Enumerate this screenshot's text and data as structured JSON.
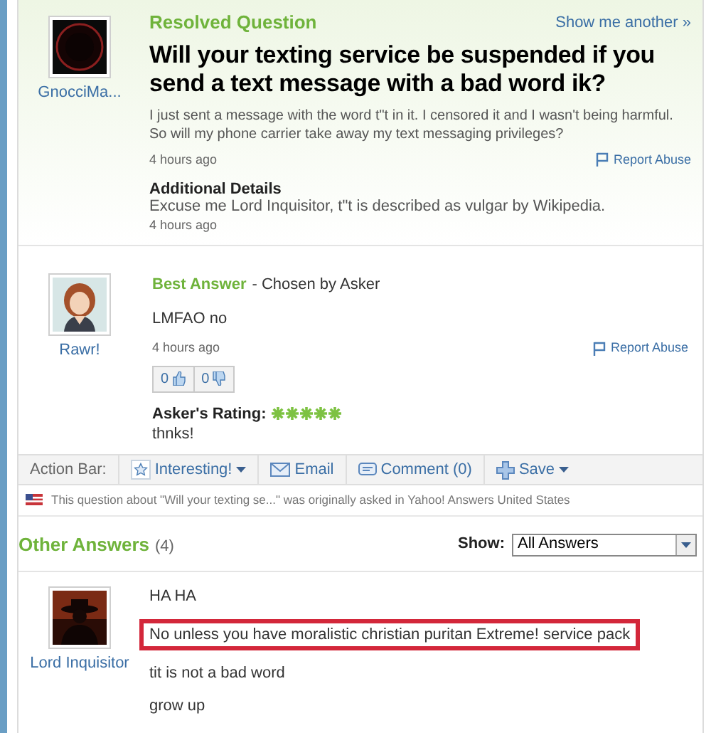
{
  "question": {
    "status": "Resolved Question",
    "show_another": "Show me another »",
    "asker": "GnocciMa...",
    "title": "Will your texting service be suspended if you send a text message with a bad word ik?",
    "body": "I just sent a message with the word t\"t in it. I censored it and I wasn't being harmful. So will my phone carrier take away my text messaging privileges?",
    "time": "4 hours ago",
    "report": "Report Abuse",
    "details_heading": "Additional Details",
    "details": "Excuse me Lord Inquisitor, t\"t is described as vulgar by Wikipedia.",
    "details_time": "4 hours ago"
  },
  "best_answer": {
    "heading": "Best Answer",
    "chosen": "- Chosen by Asker",
    "user": "Rawr!",
    "text": "LMFAO no",
    "time": "4 hours ago",
    "report": "Report Abuse",
    "thumbs_up": "0",
    "thumbs_down": "0",
    "rating_label": "Asker's Rating:",
    "stars": 5,
    "comment": "thnks!"
  },
  "action_bar": {
    "label": "Action Bar:",
    "items": [
      {
        "label": "Interesting!",
        "kind": "star",
        "dropdown": true
      },
      {
        "label": "Email",
        "kind": "mail",
        "dropdown": false
      },
      {
        "label": "Comment (0)",
        "kind": "comment",
        "dropdown": false
      },
      {
        "label": "Save",
        "kind": "plus",
        "dropdown": true
      }
    ]
  },
  "origin_note": "This question about \"Will your texting se...\" was originally asked in Yahoo! Answers United States",
  "other_answers": {
    "heading": "Other Answers",
    "count": "(4)",
    "show_label": "Show:",
    "filter": "All Answers",
    "answers": [
      {
        "user": "Lord Inquisitor",
        "lines": [
          {
            "text": "HA HA",
            "highlighted": false
          },
          {
            "text": "No unless you have moralistic christian puritan Extreme! service pack",
            "highlighted": true
          },
          {
            "text": "tit is not a bad word",
            "highlighted": false
          },
          {
            "text": "grow up",
            "highlighted": false
          }
        ]
      }
    ]
  }
}
